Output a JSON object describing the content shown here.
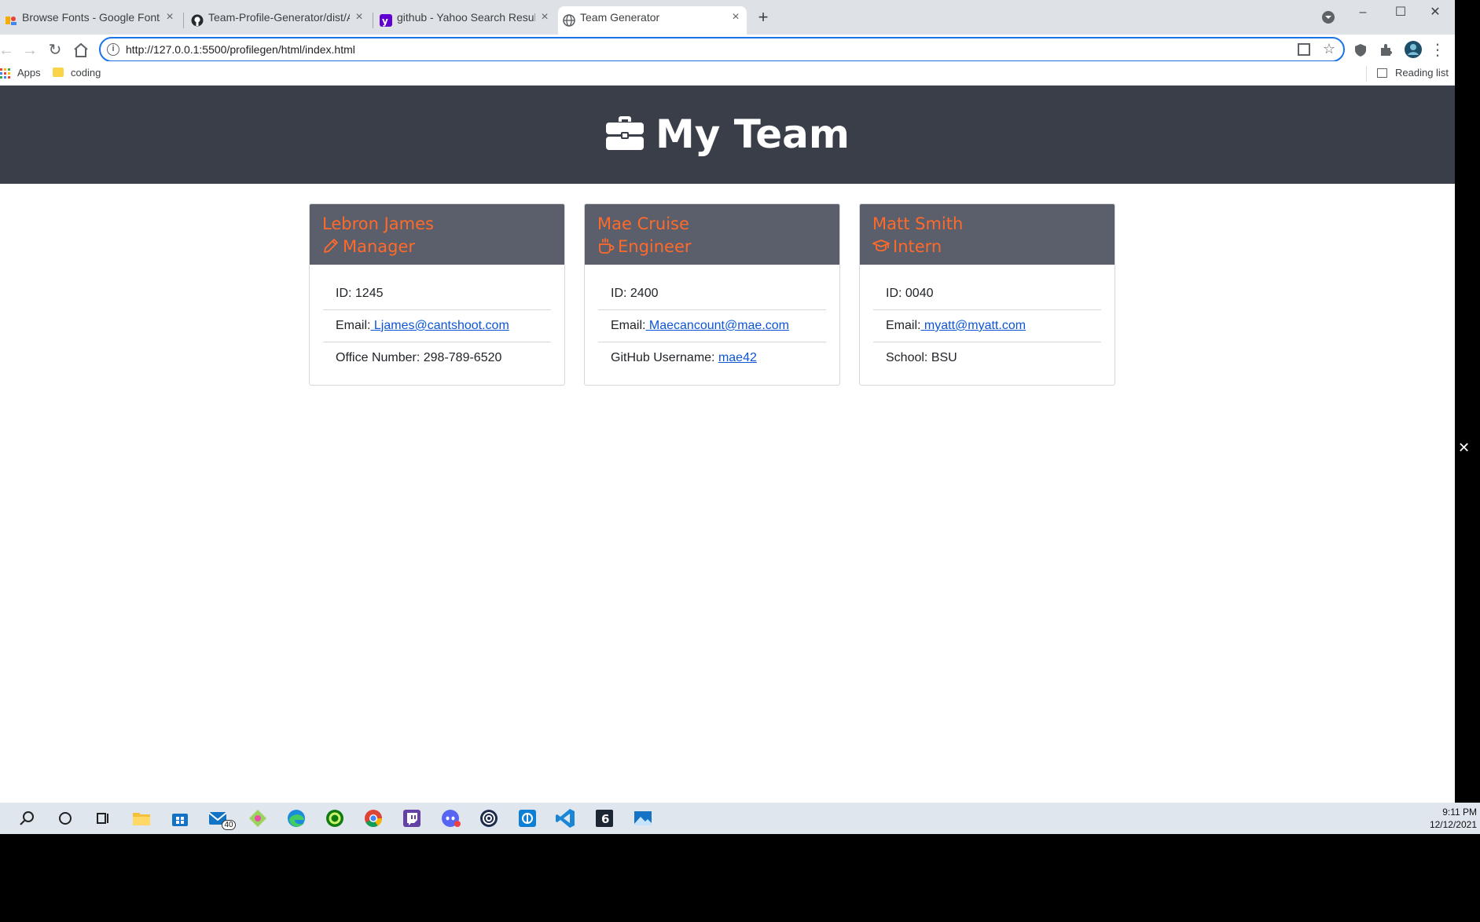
{
  "browser": {
    "tabs": [
      {
        "title": "Browse Fonts - Google Fonts",
        "icon": "google-fonts-icon",
        "active": false
      },
      {
        "title": "Team-Profile-Generator/dist/Assets",
        "icon": "github-icon",
        "active": false
      },
      {
        "title": "github - Yahoo Search Results",
        "icon": "yahoo-icon",
        "active": false
      },
      {
        "title": "Team Generator",
        "icon": "globe-icon",
        "active": true
      }
    ],
    "url": "http://127.0.0.1:5500/profilegen/html/index.html",
    "bookmarks": {
      "apps_label": "Apps",
      "folder_label": "coding",
      "reading_list_label": "Reading list"
    }
  },
  "page": {
    "title": "My Team",
    "title_icon": "briefcase-icon",
    "accent_color": "#ff6a2b",
    "header_bg": "#3a3e48",
    "cards": [
      {
        "name": "Lebron James",
        "role": "Manager",
        "role_icon": "pencil-icon",
        "id_text": "ID: 1245",
        "email_label": "Email:",
        "email": " Ljames@cantshoot.com",
        "extra_label": "Office Number: 298-789-6520",
        "extra_link": ""
      },
      {
        "name": "Mae Cruise",
        "role": "Engineer",
        "role_icon": "coffee-mug-icon",
        "id_text": "ID: 2400",
        "email_label": "Email:",
        "email": " Maecancount@mae.com",
        "extra_label": "GitHub Username: ",
        "extra_link": "mae42"
      },
      {
        "name": "Matt Smith",
        "role": "Intern",
        "role_icon": "graduation-cap-icon",
        "id_text": "ID: 0040",
        "email_label": "Email:",
        "email": " myatt@myatt.com",
        "extra_label": "School: BSU",
        "extra_link": ""
      }
    ]
  },
  "taskbar": {
    "mail_badge": "40",
    "time": "9:11 PM",
    "date": "12/12/2021"
  }
}
